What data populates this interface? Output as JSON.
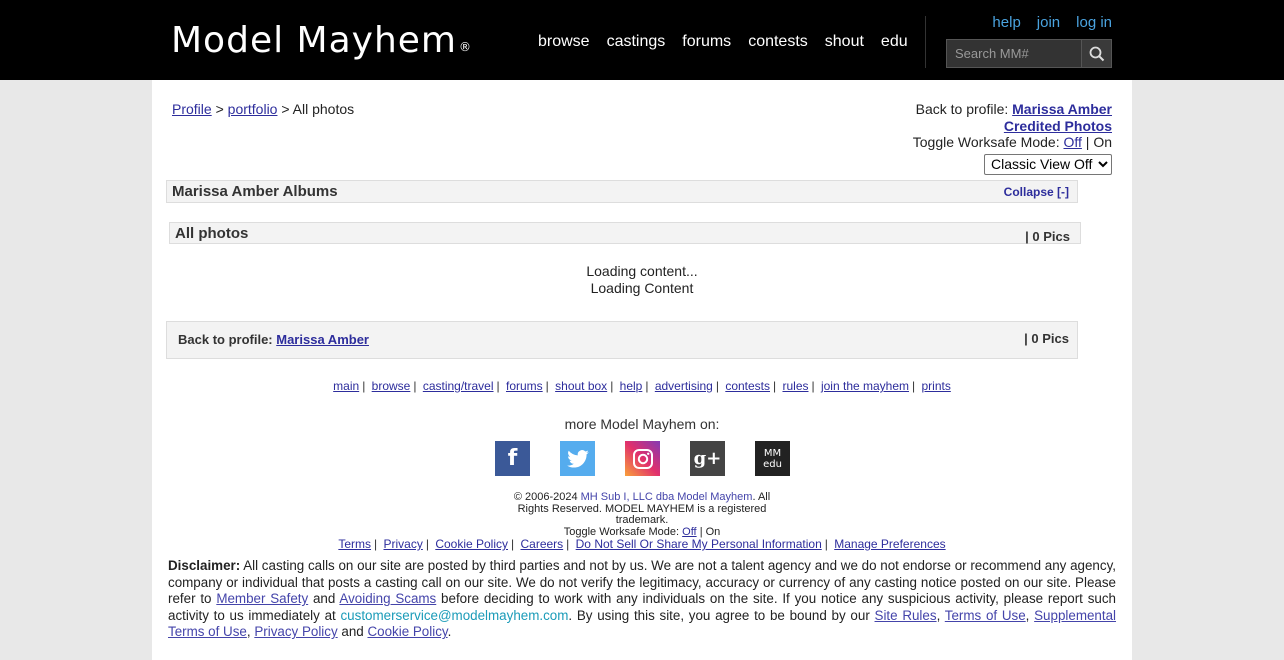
{
  "header": {
    "logo": "Model Mayhem",
    "logo_mark": "®",
    "nav": [
      "browse",
      "castings",
      "forums",
      "contests",
      "shout",
      "edu"
    ],
    "top_links": [
      "help",
      "join",
      "log in"
    ],
    "search_placeholder": "Search MM#"
  },
  "breadcrumb": {
    "profile": "Profile",
    "sep1": ">",
    "portfolio": "portfolio",
    "sep2": "> All photos"
  },
  "right_panel": {
    "back_label": "Back to profile:",
    "profile_name": "Marissa Amber",
    "credited": "Credited Photos",
    "worksafe_label": "Toggle Worksafe Mode:",
    "worksafe_off": "Off",
    "worksafe_on": "| On",
    "view_select": "Classic View Off"
  },
  "albums": {
    "title": "Marissa Amber Albums",
    "collapse": "Collapse [-]"
  },
  "all_photos": {
    "title": "All photos",
    "count": "| 0 Pics"
  },
  "loading": {
    "line1": "Loading content...",
    "line2": "Loading Content"
  },
  "back_bar": {
    "label": "Back to profile:",
    "name": "Marissa Amber",
    "count": "| 0 Pics"
  },
  "footer_links": [
    "main",
    "browse",
    "casting/travel",
    "forums",
    "shout box",
    "help",
    "advertising",
    "contests",
    "rules",
    "join the mayhem",
    "prints"
  ],
  "social": {
    "heading": "more Model Mayhem on:",
    "icons": [
      "facebook-icon",
      "twitter-icon",
      "instagram-icon",
      "google-plus-icon",
      "mm-edu-icon"
    ],
    "fb_glyph": "f",
    "gp_glyph": "g+",
    "edu_top": "MM",
    "edu_bottom": "edu"
  },
  "copyright": {
    "pre": "© 2006-2024 ",
    "company": "MH Sub I, LLC dba Model Mayhem",
    "post": ". All Rights Reserved. MODEL MAYHEM is a registered trademark.",
    "worksafe_label": "Toggle Worksafe Mode:",
    "worksafe_off": "Off",
    "worksafe_on": "| On"
  },
  "legal_links": [
    "Terms",
    "Privacy",
    "Cookie Policy",
    "Careers",
    "Do Not Sell Or Share My Personal Information",
    "Manage Preferences"
  ],
  "disclaimer": {
    "label": "Disclaimer:",
    "text1": " All casting calls on our site are posted by third parties and not by us. We are not a talent agency and we do not endorse or recommend any agency, company or individual that posts a casting call on our site. We do not verify the legitimacy, accuracy or currency of any casting notice posted on our site. Please refer to ",
    "member_safety": "Member Safety",
    "and1": " and ",
    "avoiding_scams": "Avoiding Scams",
    "text2": " before deciding to work with any individuals on the site. If you notice any suspicious activity, please report such activity to us immediately at ",
    "email": "customerservice@modelmayhem.com",
    "text3": ". By using this site, you agree to be bound by our ",
    "site_rules": "Site Rules",
    "comma1": ", ",
    "terms_of_use": "Terms of Use",
    "comma2": ", ",
    "supplemental": "Supplemental Terms of Use",
    "comma3": ", ",
    "privacy": "Privacy Policy",
    "and2": " and ",
    "cookie": "Cookie Policy",
    "period": "."
  },
  "colors": {
    "header_bg": "#000000",
    "link": "#2d2d9c",
    "top_link": "#4aa3df",
    "page_bg": "#e8e8e8"
  }
}
